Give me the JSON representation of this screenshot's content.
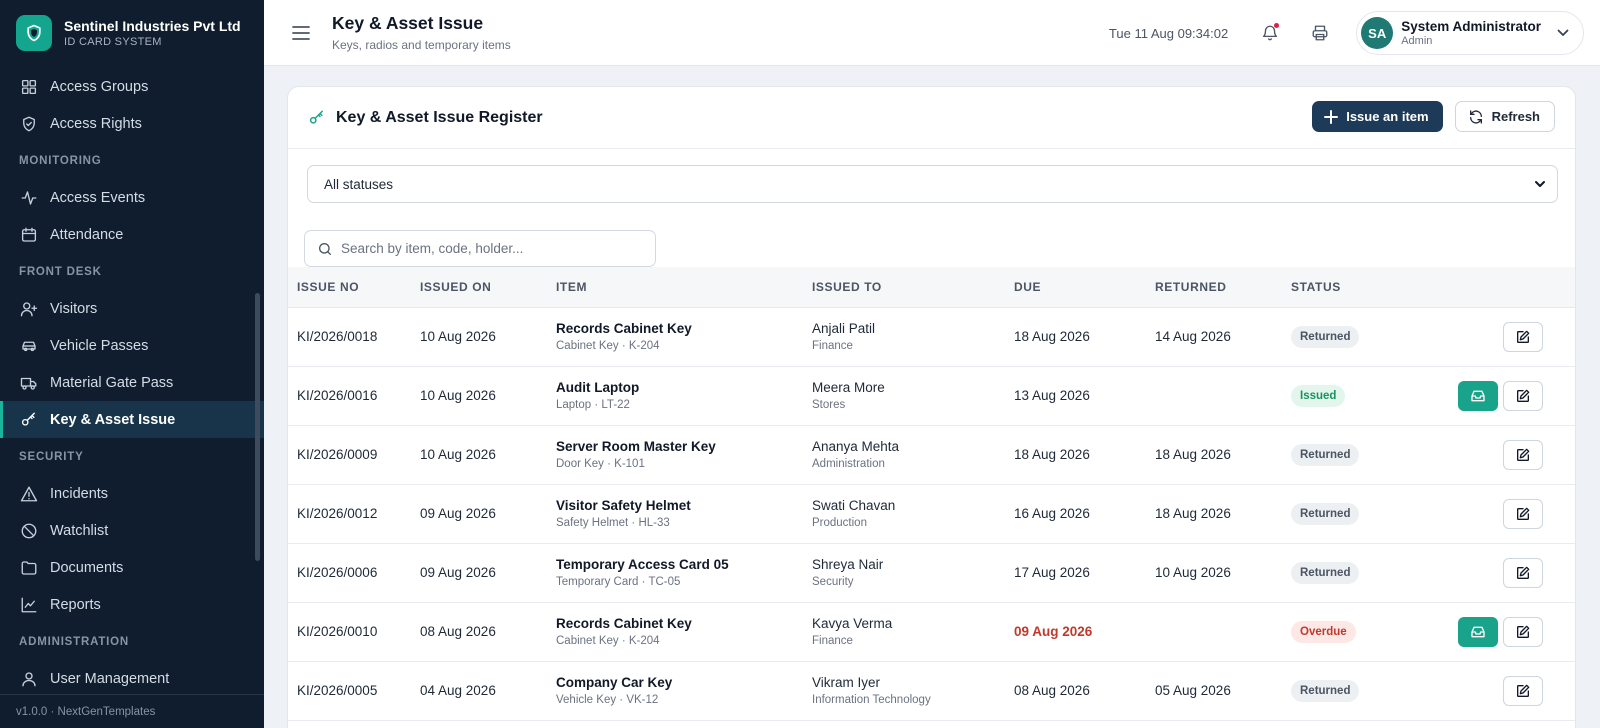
{
  "brand": {
    "name": "Sentinel Industries Pvt Ltd",
    "subtitle": "ID CARD SYSTEM",
    "icon": "shield-icon",
    "accent": "#13a58e"
  },
  "sidebar": {
    "items": [
      {
        "type": "item",
        "label": "Access Groups",
        "icon": "grid-icon"
      },
      {
        "type": "item",
        "label": "Access Rights",
        "icon": "shield-check-icon"
      },
      {
        "type": "section",
        "label": "MONITORING"
      },
      {
        "type": "item",
        "label": "Access Events",
        "icon": "activity-icon"
      },
      {
        "type": "item",
        "label": "Attendance",
        "icon": "calendar-icon"
      },
      {
        "type": "section",
        "label": "FRONT DESK"
      },
      {
        "type": "item",
        "label": "Visitors",
        "icon": "user-plus-icon"
      },
      {
        "type": "item",
        "label": "Vehicle Passes",
        "icon": "car-icon"
      },
      {
        "type": "item",
        "label": "Material Gate Pass",
        "icon": "truck-icon"
      },
      {
        "type": "item",
        "label": "Key & Asset Issue",
        "icon": "key-icon",
        "active": true
      },
      {
        "type": "section",
        "label": "SECURITY"
      },
      {
        "type": "item",
        "label": "Incidents",
        "icon": "alert-triangle-icon"
      },
      {
        "type": "item",
        "label": "Watchlist",
        "icon": "ban-icon"
      },
      {
        "type": "item",
        "label": "Documents",
        "icon": "folder-icon"
      },
      {
        "type": "item",
        "label": "Reports",
        "icon": "line-chart-icon"
      },
      {
        "type": "section",
        "label": "ADMINISTRATION"
      },
      {
        "type": "item",
        "label": "User Management",
        "icon": "user-icon"
      }
    ],
    "version": "v1.0.0 · NextGenTemplates"
  },
  "header": {
    "title": "Key & Asset Issue",
    "subtitle": "Keys, radios and temporary items",
    "datetime": "Tue 11 Aug 09:34:02",
    "user": {
      "initials": "SA",
      "name": "System Administrator",
      "role": "Admin"
    }
  },
  "card": {
    "title": "Key & Asset Issue Register",
    "issue_button": "Issue an item",
    "refresh_button": "Refresh",
    "status_filter": "All statuses",
    "search_placeholder": "Search by item, code, holder..."
  },
  "table": {
    "columns": [
      "ISSUE NO",
      "ISSUED ON",
      "ITEM",
      "ISSUED TO",
      "DUE",
      "RETURNED",
      "STATUS",
      ""
    ],
    "rows": [
      {
        "issue_no": "KI/2026/0018",
        "issued_on": "10 Aug 2026",
        "item": "Records Cabinet Key",
        "item_sub": "Cabinet Key · K-204",
        "holder": "Anjali Patil",
        "dept": "Finance",
        "due": "18 Aug 2026",
        "returned": "14 Aug 2026",
        "status": "Returned"
      },
      {
        "issue_no": "KI/2026/0016",
        "issued_on": "10 Aug 2026",
        "item": "Audit Laptop",
        "item_sub": "Laptop · LT-22",
        "holder": "Meera More",
        "dept": "Stores",
        "due": "13 Aug 2026",
        "returned": "",
        "status": "Issued"
      },
      {
        "issue_no": "KI/2026/0009",
        "issued_on": "10 Aug 2026",
        "item": "Server Room Master Key",
        "item_sub": "Door Key · K-101",
        "holder": "Ananya Mehta",
        "dept": "Administration",
        "due": "18 Aug 2026",
        "returned": "18 Aug 2026",
        "status": "Returned"
      },
      {
        "issue_no": "KI/2026/0012",
        "issued_on": "09 Aug 2026",
        "item": "Visitor Safety Helmet",
        "item_sub": "Safety Helmet · HL-33",
        "holder": "Swati Chavan",
        "dept": "Production",
        "due": "16 Aug 2026",
        "returned": "18 Aug 2026",
        "status": "Returned"
      },
      {
        "issue_no": "KI/2026/0006",
        "issued_on": "09 Aug 2026",
        "item": "Temporary Access Card 05",
        "item_sub": "Temporary Card · TC-05",
        "holder": "Shreya Nair",
        "dept": "Security",
        "due": "17 Aug 2026",
        "returned": "10 Aug 2026",
        "status": "Returned"
      },
      {
        "issue_no": "KI/2026/0010",
        "issued_on": "08 Aug 2026",
        "item": "Records Cabinet Key",
        "item_sub": "Cabinet Key · K-204",
        "holder": "Kavya Verma",
        "dept": "Finance",
        "due": "09 Aug 2026",
        "returned": "",
        "status": "Overdue"
      },
      {
        "issue_no": "KI/2026/0005",
        "issued_on": "04 Aug 2026",
        "item": "Company Car Key",
        "item_sub": "Vehicle Key · VK-12",
        "holder": "Vikram Iyer",
        "dept": "Information Technology",
        "due": "08 Aug 2026",
        "returned": "05 Aug 2026",
        "status": "Returned"
      }
    ]
  },
  "colors": {
    "sidebar_bg": "#0f1d2e",
    "primary": "#1d3a58",
    "teal": "#1aa38b",
    "overdue": "#c0392b",
    "issued": "#19925f"
  }
}
